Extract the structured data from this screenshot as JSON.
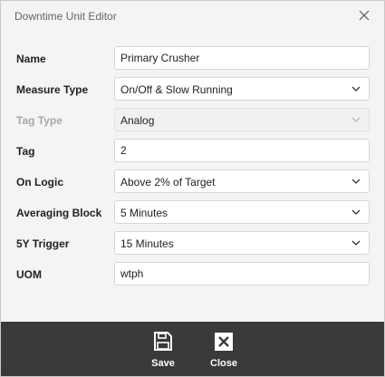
{
  "dialog": {
    "title": "Downtime Unit Editor",
    "close_icon": "close-icon"
  },
  "fields": [
    {
      "label": "Name",
      "value": "Primary Crusher",
      "type": "text",
      "disabled": false
    },
    {
      "label": "Measure Type",
      "value": "On/Off & Slow Running",
      "type": "select",
      "disabled": false
    },
    {
      "label": "Tag Type",
      "value": "Analog",
      "type": "select",
      "disabled": true
    },
    {
      "label": "Tag",
      "value": "2",
      "type": "text",
      "disabled": false
    },
    {
      "label": "On Logic",
      "value": "Above 2% of Target",
      "type": "select",
      "disabled": false
    },
    {
      "label": "Averaging Block",
      "value": "5 Minutes",
      "type": "select",
      "disabled": false
    },
    {
      "label": "5Y Trigger",
      "value": "15 Minutes",
      "type": "select",
      "disabled": false
    },
    {
      "label": "UOM",
      "value": "wtph",
      "type": "text",
      "disabled": false
    }
  ],
  "footer": {
    "save_label": "Save",
    "save_icon": "save-icon",
    "close_label": "Close",
    "close_icon": "close-box-icon"
  },
  "colors": {
    "footer_bg": "#3a3a3a",
    "body_bg": "#f4f4f4",
    "label": "#222222",
    "disabled_label": "#a8a8a8"
  }
}
